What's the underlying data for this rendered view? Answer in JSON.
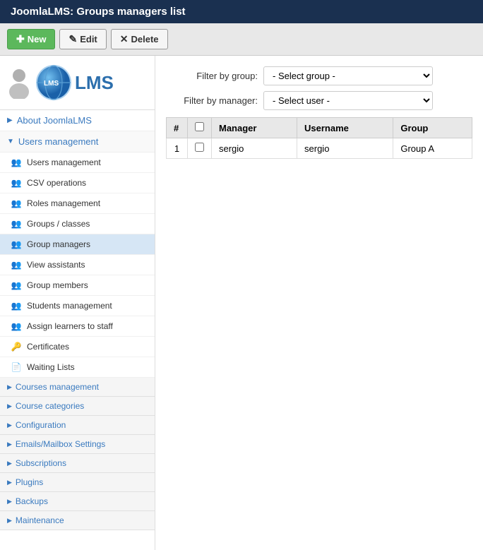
{
  "titleBar": {
    "title": "JoomlaLMS: Groups managers list"
  },
  "toolbar": {
    "newLabel": "New",
    "editLabel": "Edit",
    "deleteLabel": "Delete"
  },
  "sidebar": {
    "logo": {
      "alt": "JoomlaLMS Logo"
    },
    "aboutLabel": "About JoomlaLMS",
    "usersManagement": {
      "sectionLabel": "Users management",
      "items": [
        {
          "label": "Users management",
          "icon": "users-icon"
        },
        {
          "label": "CSV operations",
          "icon": "users-icon"
        },
        {
          "label": "Roles management",
          "icon": "users-icon"
        },
        {
          "label": "Groups / classes",
          "icon": "users-icon"
        },
        {
          "label": "Group managers",
          "icon": "users-icon",
          "active": true
        },
        {
          "label": "View assistants",
          "icon": "users-icon"
        },
        {
          "label": "Group members",
          "icon": "users-icon"
        },
        {
          "label": "Students management",
          "icon": "users-icon"
        },
        {
          "label": "Assign learners to staff",
          "icon": "users-icon"
        },
        {
          "label": "Certificates",
          "icon": "cert-icon"
        },
        {
          "label": "Waiting Lists",
          "icon": "list-icon"
        }
      ]
    },
    "sections": [
      {
        "label": "Courses management"
      },
      {
        "label": "Course categories"
      },
      {
        "label": "Configuration"
      },
      {
        "label": "Emails/Mailbox Settings"
      },
      {
        "label": "Subscriptions"
      },
      {
        "label": "Plugins"
      },
      {
        "label": "Backups"
      },
      {
        "label": "Maintenance"
      }
    ]
  },
  "filters": {
    "filterByGroupLabel": "Filter by group:",
    "filterByManagerLabel": "Filter by manager:",
    "selectGroupPlaceholder": "- Select group -",
    "selectUserPlaceholder": "- Select user -",
    "groupOptions": [
      "- Select group -"
    ],
    "userOptions": [
      "- Select user -"
    ]
  },
  "table": {
    "columns": [
      "#",
      "",
      "Manager",
      "Username",
      "Group"
    ],
    "rows": [
      {
        "num": 1,
        "manager": "sergio",
        "username": "sergio",
        "group": "Group A"
      }
    ]
  }
}
